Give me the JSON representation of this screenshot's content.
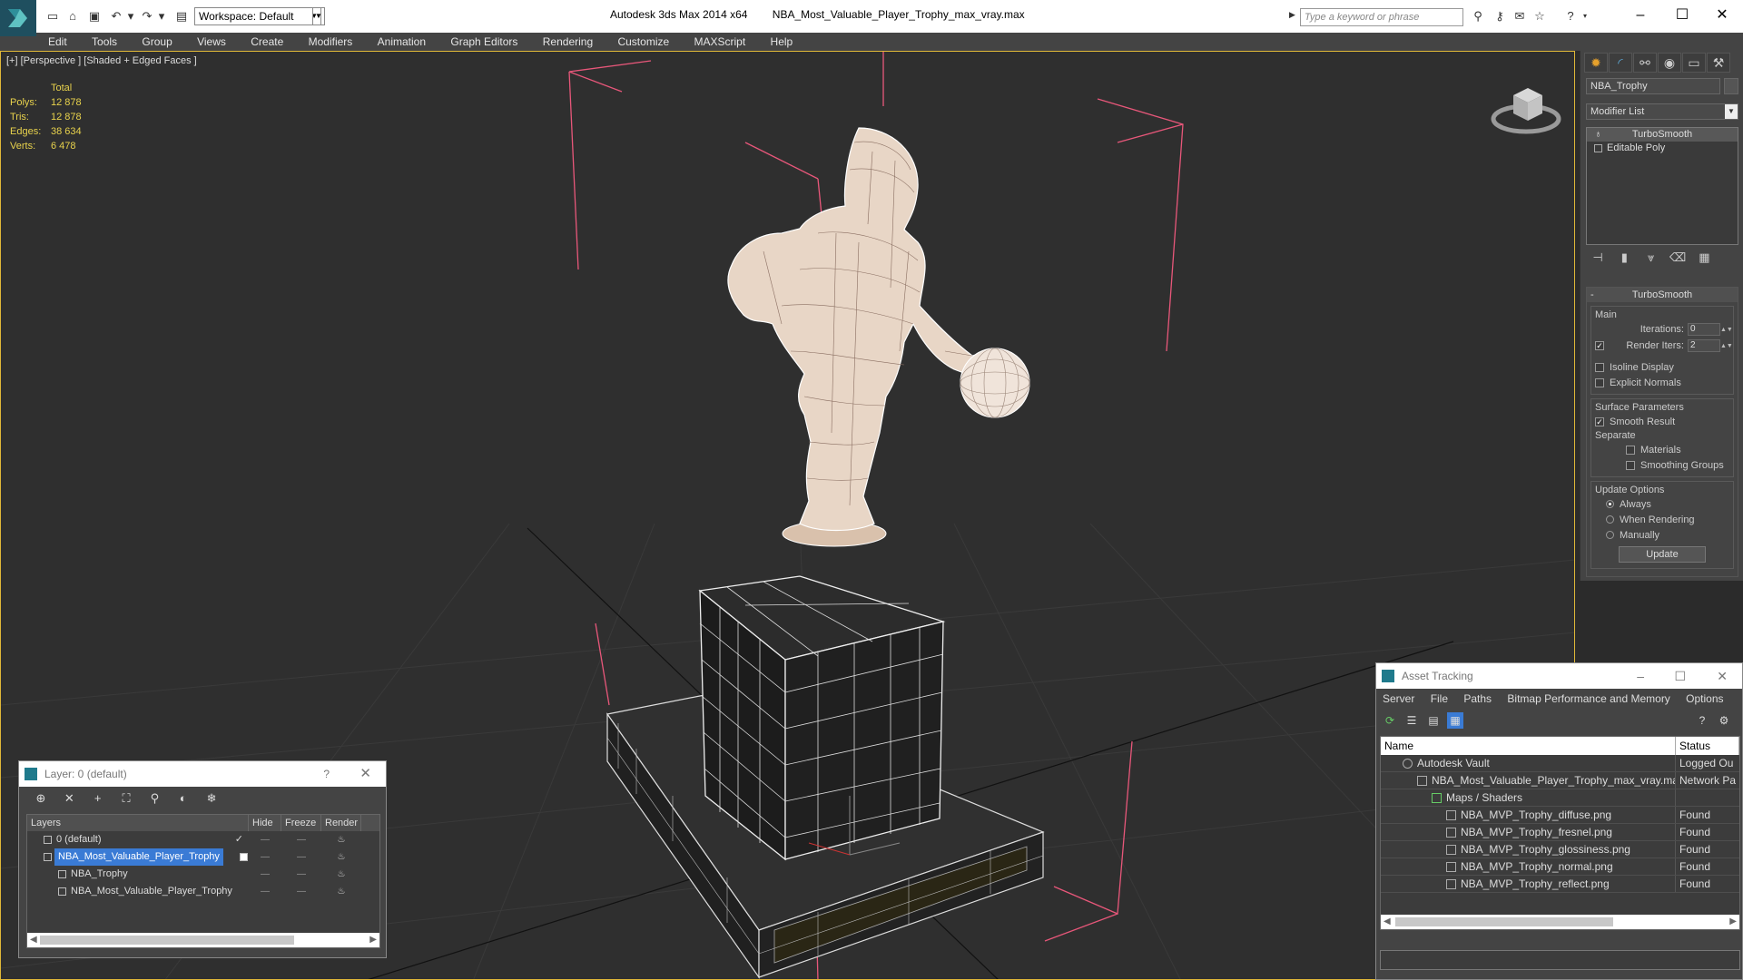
{
  "titlebar": {
    "workspace": "Workspace: Default",
    "app_name": "Autodesk 3ds Max  2014 x64",
    "file_name": "NBA_Most_Valuable_Player_Trophy_max_vray.max",
    "search_placeholder": "Type a keyword or phrase"
  },
  "menu": [
    "Edit",
    "Tools",
    "Group",
    "Views",
    "Create",
    "Modifiers",
    "Animation",
    "Graph Editors",
    "Rendering",
    "Customize",
    "MAXScript",
    "Help"
  ],
  "viewport": {
    "label": "[+] [Perspective ] [Shaded + Edged Faces ]",
    "stats": {
      "header": "Total",
      "rows": [
        {
          "k": "Polys:",
          "v": "12 878"
        },
        {
          "k": "Tris:",
          "v": "12 878"
        },
        {
          "k": "Edges:",
          "v": "38 634"
        },
        {
          "k": "Verts:",
          "v": "6 478"
        }
      ]
    }
  },
  "command_panel": {
    "object_name": "NBA_Trophy",
    "modifier_list": "Modifier List",
    "stack": [
      "TurboSmooth",
      "Editable Poly"
    ],
    "rollout": {
      "title": "TurboSmooth",
      "main_label": "Main",
      "iterations_label": "Iterations:",
      "iterations_value": "0",
      "render_iters_label": "Render Iters:",
      "render_iters_value": "2",
      "isoline": "Isoline Display",
      "explicit_normals": "Explicit Normals",
      "surface_label": "Surface Parameters",
      "smooth_result": "Smooth Result",
      "separate_label": "Separate",
      "materials": "Materials",
      "smoothing_groups": "Smoothing Groups",
      "update_options": "Update Options",
      "always": "Always",
      "when_rendering": "When Rendering",
      "manually": "Manually",
      "update_button": "Update"
    }
  },
  "layer_dialog": {
    "title": "Layer: 0 (default)",
    "help": "?",
    "columns": [
      "Layers",
      "Hide",
      "Freeze",
      "Render"
    ],
    "rows": [
      {
        "name": "0 (default)",
        "indent": 1
      },
      {
        "name": "NBA_Most_Valuable_Player_Trophy",
        "indent": 1
      },
      {
        "name": "NBA_Trophy",
        "indent": 2
      },
      {
        "name": "NBA_Most_Valuable_Player_Trophy",
        "indent": 2
      }
    ]
  },
  "asset_dialog": {
    "title": "Asset Tracking",
    "menu": [
      "Server",
      "File",
      "Paths",
      "Bitmap Performance and Memory",
      "Options"
    ],
    "columns": [
      "Name",
      "Status"
    ],
    "rows": [
      {
        "name": "Autodesk Vault",
        "status": "Logged Ou",
        "indent": 1
      },
      {
        "name": "NBA_Most_Valuable_Player_Trophy_max_vray.max",
        "status": "Network Pa",
        "indent": 2
      },
      {
        "name": "Maps / Shaders",
        "status": "",
        "indent": 3
      },
      {
        "name": "NBA_MVP_Trophy_diffuse.png",
        "status": "Found",
        "indent": 4
      },
      {
        "name": "NBA_MVP_Trophy_fresnel.png",
        "status": "Found",
        "indent": 4
      },
      {
        "name": "NBA_MVP_Trophy_glossiness.png",
        "status": "Found",
        "indent": 4
      },
      {
        "name": "NBA_MVP_Trophy_normal.png",
        "status": "Found",
        "indent": 4
      },
      {
        "name": "NBA_MVP_Trophy_reflect.png",
        "status": "Found",
        "indent": 4
      }
    ]
  },
  "colors": {
    "selection": "#3a7bd5",
    "viewport_border": "#e0b838",
    "stats_text": "#e8d24c",
    "bbox": "#e8577a"
  }
}
